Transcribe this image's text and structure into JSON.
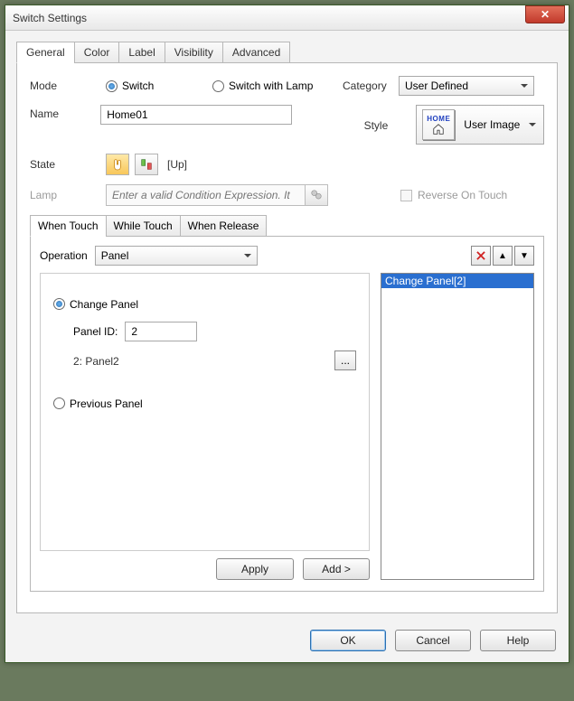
{
  "window": {
    "title": "Switch Settings"
  },
  "tabs": [
    "General",
    "Color",
    "Label",
    "Visibility",
    "Advanced"
  ],
  "active_tab": 0,
  "labels": {
    "mode": "Mode",
    "name": "Name",
    "state": "State",
    "lamp": "Lamp",
    "category": "Category",
    "style": "Style",
    "reverse": "Reverse On Touch",
    "operation": "Operation",
    "panel_id": "Panel ID:"
  },
  "mode": {
    "switch": "Switch",
    "switch_with_lamp": "Switch with Lamp",
    "selected": "switch"
  },
  "name_value": "Home01",
  "state": {
    "text": "[Up]"
  },
  "lamp": {
    "placeholder": "Enter a valid Condition Expression. It"
  },
  "category": {
    "value": "User Defined"
  },
  "style": {
    "value": "User Image",
    "home_text": "HOME"
  },
  "subtabs": [
    "When Touch",
    "While Touch",
    "When Release"
  ],
  "active_subtab": 0,
  "operation": {
    "value": "Panel"
  },
  "panel_opts": {
    "change_panel": "Change Panel",
    "previous_panel": "Previous Panel",
    "selected": "change_panel",
    "panel_id_value": "2",
    "panel_name": "2: Panel2"
  },
  "list": {
    "items": [
      "Change Panel[2]"
    ]
  },
  "buttons": {
    "apply": "Apply",
    "add": "Add >",
    "ok": "OK",
    "cancel": "Cancel",
    "help": "Help"
  },
  "icons": {
    "close": "✕",
    "dots": "...",
    "arrow_up": "▲",
    "arrow_down": "▼"
  }
}
